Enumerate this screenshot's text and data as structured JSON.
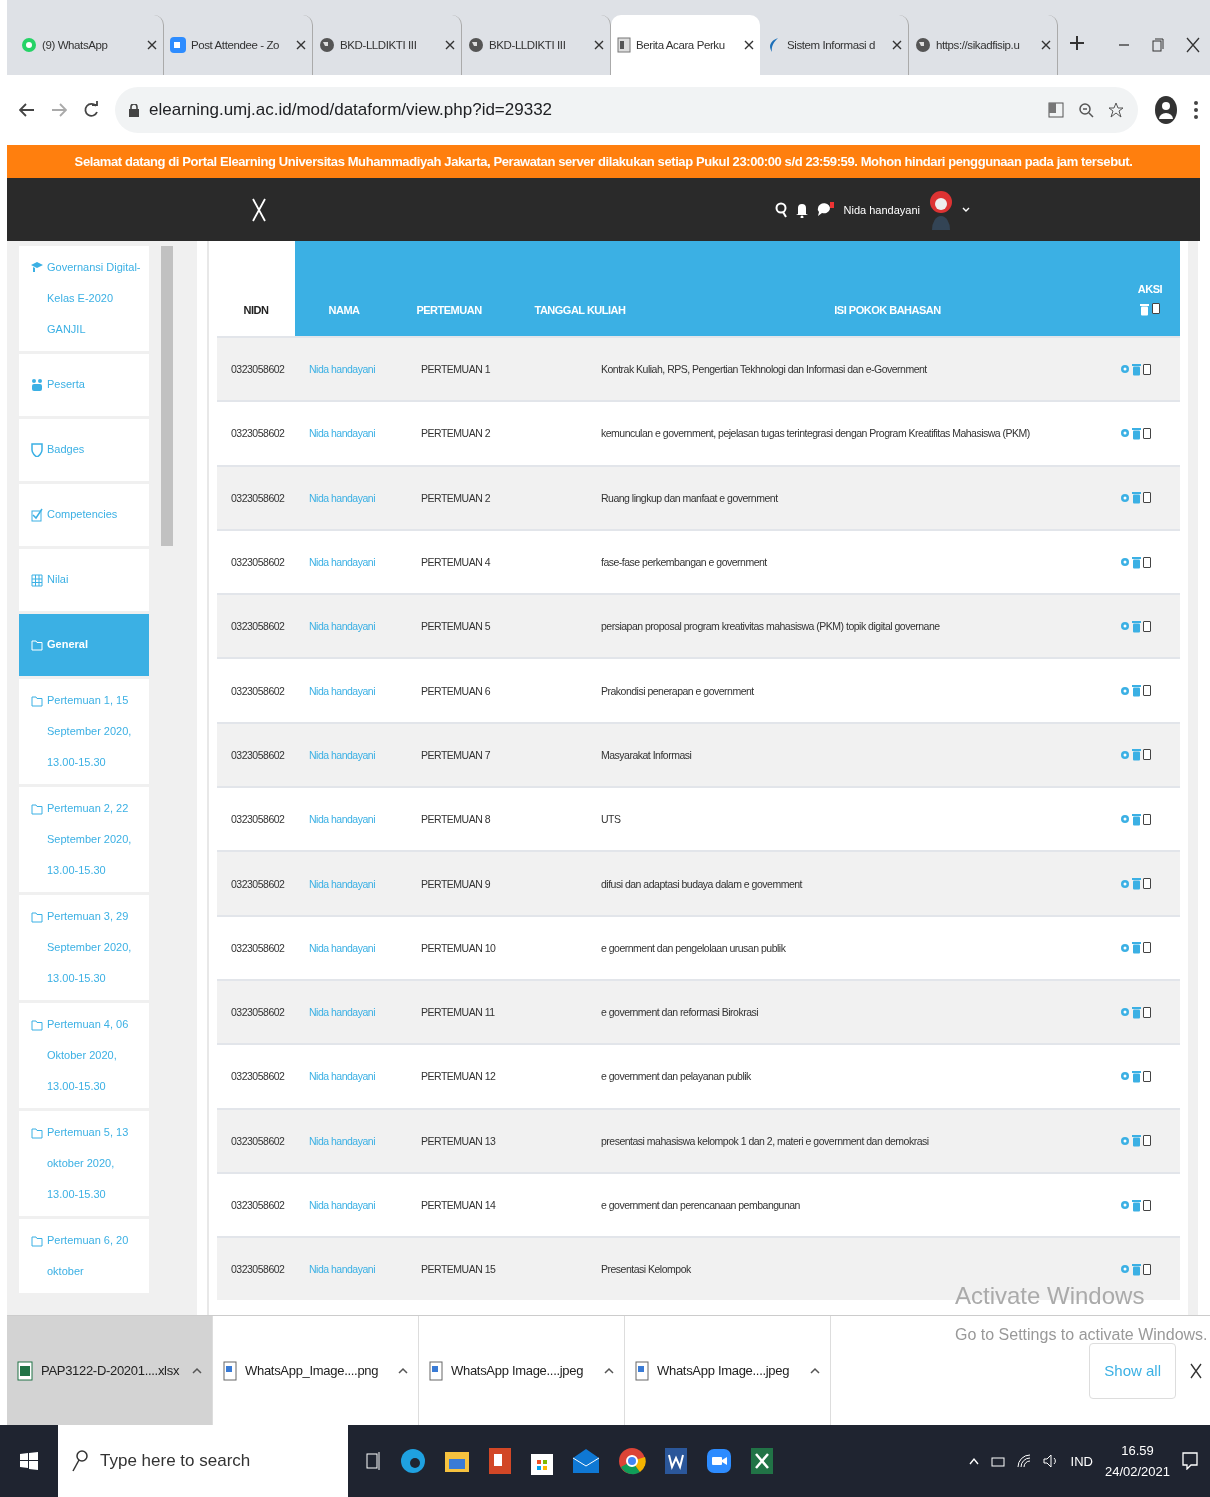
{
  "browser": {
    "tabs": [
      {
        "title": "(9) WhatsApp",
        "kind": "chat",
        "selected": false
      },
      {
        "title": "Post Attendee - Zo",
        "kind": "video",
        "selected": false
      },
      {
        "title": "BKD-LLDIKTI III",
        "kind": "web",
        "selected": false
      },
      {
        "title": "BKD-LLDIKTI III",
        "kind": "web",
        "selected": false
      },
      {
        "title": "Berita Acara Perku",
        "kind": "document",
        "selected": true
      },
      {
        "title": "Sistem Informasi d",
        "kind": "portal",
        "selected": false
      },
      {
        "title": "https://sikadfisip.u",
        "kind": "web",
        "selected": false
      }
    ],
    "url": "elearning.umj.ac.id/mod/dataform/view.php?id=29332"
  },
  "banner": "Selamat datang di Portal Elearning Universitas Muhammadiyah Jakarta, Perawatan server dilakukan setiap Pukul 23:00:00 s/d 23:59:59. Mohon hindari penggunaan pada jam tersebut.",
  "navbar": {
    "user": "Nida handayani"
  },
  "sidebar": {
    "items": [
      {
        "label": "Governansi Digital-Kelas E-2020 GANJIL",
        "kind": "course",
        "selected": false
      },
      {
        "label": "Peserta",
        "kind": "people",
        "selected": false
      },
      {
        "label": "Badges",
        "kind": "badge",
        "selected": false
      },
      {
        "label": "Competencies",
        "kind": "check",
        "selected": false
      },
      {
        "label": "Nilai",
        "kind": "grid",
        "selected": false
      },
      {
        "label": "General",
        "kind": "folder",
        "selected": true
      },
      {
        "label": "Pertemuan 1, 15 September 2020, 13.00-15.30",
        "kind": "folder",
        "selected": false
      },
      {
        "label": "Pertemuan 2, 22 September 2020, 13.00-15.30",
        "kind": "folder",
        "selected": false
      },
      {
        "label": "Pertemuan 3, 29 September 2020, 13.00-15.30",
        "kind": "folder",
        "selected": false
      },
      {
        "label": "Pertemuan 4, 06 Oktober 2020, 13.00-15.30",
        "kind": "folder",
        "selected": false
      },
      {
        "label": "Pertemuan 5, 13 oktober 2020, 13.00-15.30",
        "kind": "folder",
        "selected": false
      },
      {
        "label": "Pertemuan 6, 20 oktober",
        "kind": "folder",
        "selected": false
      }
    ]
  },
  "table": {
    "columns": [
      {
        "label": "NIDN",
        "highlighted": false
      },
      {
        "label": "NAMA",
        "highlighted": true
      },
      {
        "label": "PERTEMUAN",
        "highlighted": true
      },
      {
        "label": "TANGGAL KULIAH",
        "highlighted": true
      },
      {
        "label": "ISI POKOK BAHASAN",
        "highlighted": true
      },
      {
        "label": "AKSI",
        "highlighted": true
      }
    ],
    "rows": [
      {
        "nidn": "0323058602",
        "nama": "Nida handayani",
        "pertemuan": "PERTEMUAN 1",
        "isi": "Kontrak Kuliah, RPS, Pengertian Tekhnologi dan Informasi dan e-Government",
        "checked": false
      },
      {
        "nidn": "0323058602",
        "nama": "Nida handayani",
        "pertemuan": "PERTEMUAN 2",
        "isi": "kemunculan e government, pejelasan tugas terintegrasi dengan Program Kreatifitas Mahasiswa (PKM)",
        "checked": false
      },
      {
        "nidn": "0323058602",
        "nama": "Nida handayani",
        "pertemuan": "PERTEMUAN 2",
        "isi": "Ruang lingkup dan manfaat e government",
        "checked": false
      },
      {
        "nidn": "0323058602",
        "nama": "Nida handayani",
        "pertemuan": "PERTEMUAN 4",
        "isi": "fase-fase perkembangan e government",
        "checked": false
      },
      {
        "nidn": "0323058602",
        "nama": "Nida handayani",
        "pertemuan": "PERTEMUAN 5",
        "isi": "persiapan proposal program kreativitas mahasiswa (PKM) topik digital governane",
        "checked": false
      },
      {
        "nidn": "0323058602",
        "nama": "Nida handayani",
        "pertemuan": "PERTEMUAN 6",
        "isi": "Prakondisi penerapan e government",
        "checked": false
      },
      {
        "nidn": "0323058602",
        "nama": "Nida handayani",
        "pertemuan": "PERTEMUAN 7",
        "isi": "Masyarakat Informasi",
        "checked": false
      },
      {
        "nidn": "0323058602",
        "nama": "Nida handayani",
        "pertemuan": "PERTEMUAN 8",
        "isi": "UTS",
        "checked": false
      },
      {
        "nidn": "0323058602",
        "nama": "Nida handayani",
        "pertemuan": "PERTEMUAN 9",
        "isi": "difusi dan adaptasi  budaya dalam e govemment",
        "checked": false
      },
      {
        "nidn": "0323058602",
        "nama": "Nida handayani",
        "pertemuan": "PERTEMUAN 10",
        "isi": "e goernment dan pengelolaan urusan publik",
        "checked": false
      },
      {
        "nidn": "0323058602",
        "nama": "Nida handayani",
        "pertemuan": "PERTEMUAN 11",
        "isi": "e government dan reformasi Birokrasi",
        "checked": false
      },
      {
        "nidn": "0323058602",
        "nama": "Nida handayani",
        "pertemuan": "PERTEMUAN 12",
        "isi": "e  government dan pelayanan publik",
        "checked": false
      },
      {
        "nidn": "0323058602",
        "nama": "Nida handayani",
        "pertemuan": "PERTEMUAN 13",
        "isi": "presentasi mahasiswa kelompok 1 dan 2, materi e government dan demokrasi",
        "checked": false
      },
      {
        "nidn": "0323058602",
        "nama": "Nida handayani",
        "pertemuan": "PERTEMUAN 14",
        "isi": "e government  dan perencanaan pembangunan",
        "checked": false
      },
      {
        "nidn": "0323058602",
        "nama": "Nida handayani",
        "pertemuan": "PERTEMUAN 15",
        "isi": "Presentasi Kelompok",
        "checked": false
      }
    ]
  },
  "windows_notice": {
    "title": "Activate Windows",
    "text": "Go to Settings to activate Windows."
  },
  "downloads": {
    "items": [
      {
        "name": "PAP3122-D-20201....xlsx",
        "kind": "sheet",
        "selected": true
      },
      {
        "name": "WhatsApp_Image....png",
        "kind": "image",
        "selected": false
      },
      {
        "name": "WhatsApp Image....jpeg",
        "kind": "image",
        "selected": false
      },
      {
        "name": "WhatsApp Image....jpeg",
        "kind": "image",
        "selected": false
      }
    ],
    "show_all": "Show all"
  },
  "taskbar": {
    "search_placeholder": "Type here to search",
    "language": "IND",
    "time": "16.59",
    "date": "24/02/2021"
  }
}
